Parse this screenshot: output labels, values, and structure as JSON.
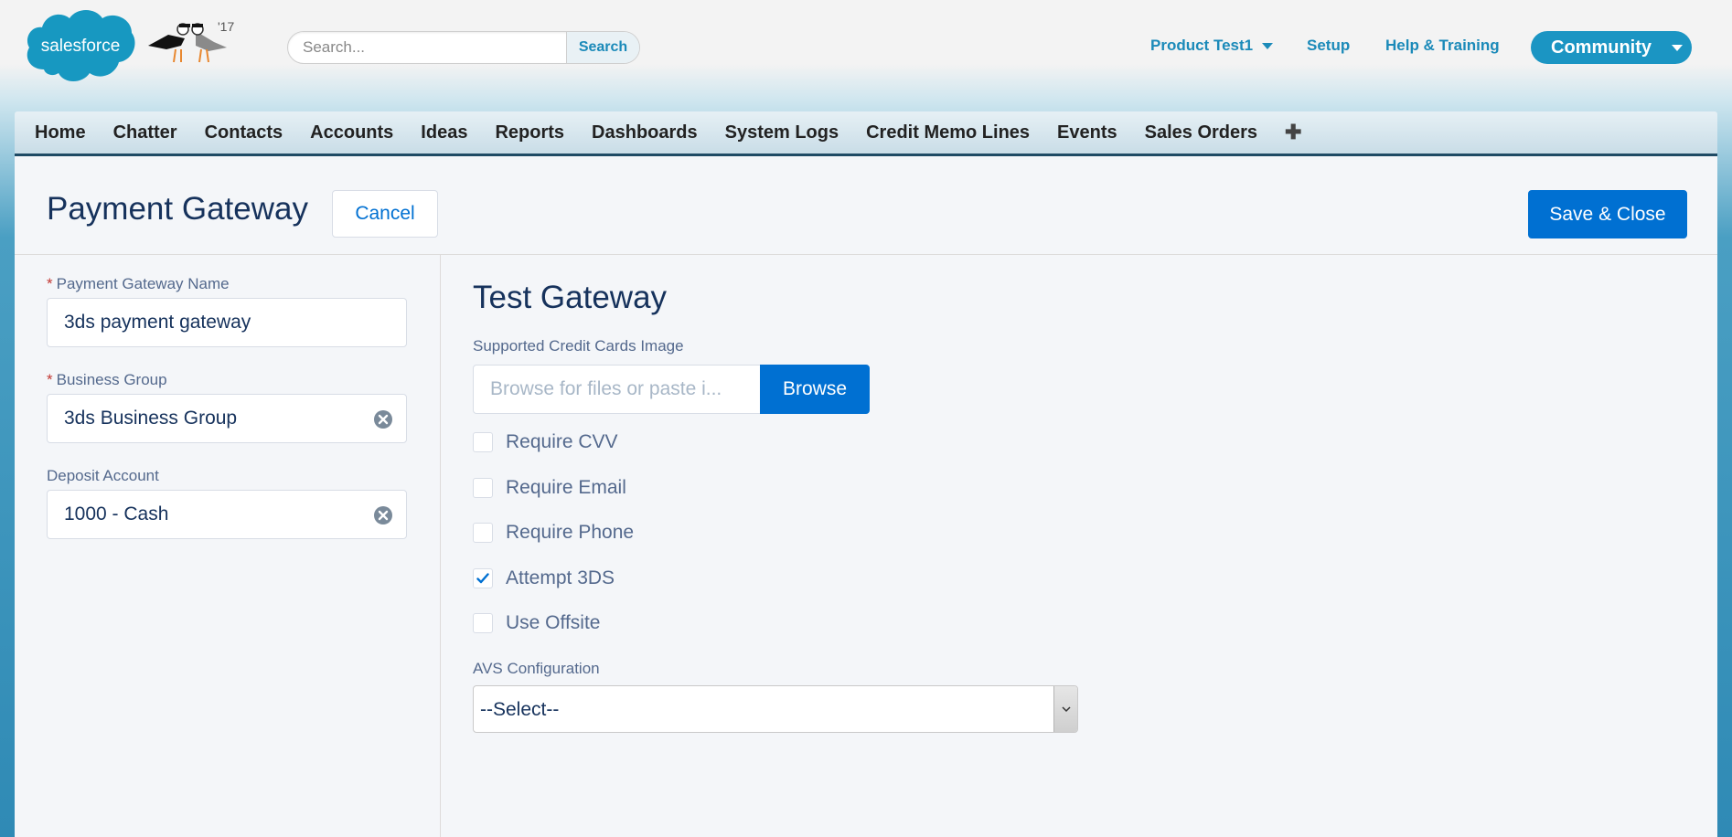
{
  "header": {
    "logo_text": "salesforce",
    "mascot_badge": "'17",
    "search": {
      "placeholder": "Search...",
      "value": "",
      "button_label": "Search"
    },
    "links": {
      "app_menu": "Product Test1",
      "setup": "Setup",
      "help": "Help & Training"
    },
    "community_label": "Community"
  },
  "tabs": [
    "Home",
    "Chatter",
    "Contacts",
    "Accounts",
    "Ideas",
    "Reports",
    "Dashboards",
    "System Logs",
    "Credit Memo Lines",
    "Events",
    "Sales Orders"
  ],
  "tab_add_icon": "plus-icon",
  "page": {
    "title": "Payment Gateway",
    "cancel_label": "Cancel",
    "save_label": "Save & Close"
  },
  "form": {
    "name_label": "Payment Gateway Name",
    "name_value": "3ds payment gateway",
    "business_group_label": "Business Group",
    "business_group_value": "3ds Business Group",
    "deposit_label": "Deposit Account",
    "deposit_value": "1000 - Cash"
  },
  "gateway": {
    "title": "Test Gateway",
    "image_label": "Supported Credit Cards Image",
    "image_placeholder": "Browse for files or paste i...",
    "browse_label": "Browse",
    "checkboxes": [
      {
        "label": "Require CVV",
        "checked": false
      },
      {
        "label": "Require Email",
        "checked": false
      },
      {
        "label": "Require Phone",
        "checked": false
      },
      {
        "label": "Attempt 3DS",
        "checked": true
      },
      {
        "label": "Use Offsite",
        "checked": false
      }
    ],
    "avs_label": "AVS Configuration",
    "avs_value": "--Select--"
  },
  "colors": {
    "brand_blue": "#0070d2",
    "link_blue": "#1b8ab9",
    "heading": "#16325c",
    "required": "#c23934"
  }
}
